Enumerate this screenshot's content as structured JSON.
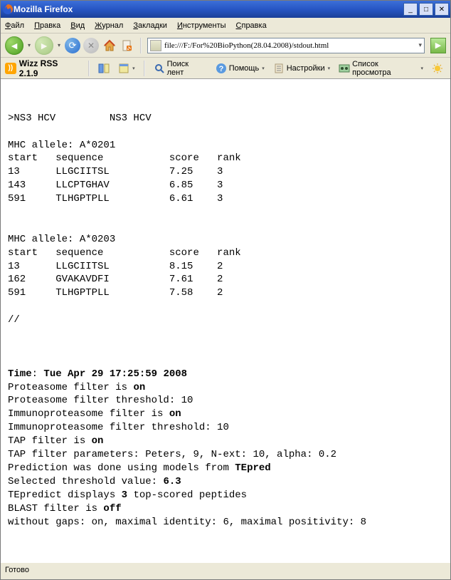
{
  "window": {
    "title": "Mozilla Firefox"
  },
  "menu": {
    "file": "Файл",
    "edit": "Правка",
    "view": "Вид",
    "history": "Журнал",
    "bookmarks": "Закладки",
    "tools": "Инструменты",
    "help": "Справка"
  },
  "url": {
    "value": "file:///F:/For%20BioPython(28.04.2008)/stdout.html"
  },
  "rss": {
    "label": "Wizz RSS 2.1.9"
  },
  "toolbar2": {
    "search": "Поиск лент",
    "help": "Помощь",
    "settings": "Настройки",
    "viewlist": "Список просмотра"
  },
  "status": {
    "text": "Готово"
  },
  "doc": {
    "header": ">NS3 HCV         NS3 HCV",
    "alleles": [
      {
        "name": "MHC allele: A*0201",
        "cols": "start   sequence           score   rank",
        "rows": [
          "13      LLGCIITSL          7.25    3",
          "143     LLCPTGHAV          6.85    3",
          "591     TLHGPTPLL          6.61    3"
        ]
      },
      {
        "name": "MHC allele: A*0203",
        "cols": "start   sequence           score   rank",
        "rows": [
          "13      LLGCIITSL          8.15    2",
          "162     GVAKAVDFI          7.61    2",
          "591     TLHGPTPLL          7.58    2"
        ]
      }
    ],
    "sep": "//",
    "time_label": "Time",
    "time_value": "Tue Apr 29 17:25:59 2008",
    "l1a": "Proteasome filter is ",
    "l1b": "on",
    "l2": "Proteasome filter threshold: 10",
    "l3a": "Immunoproteasome filter is ",
    "l3b": "on",
    "l4": "Immunoproteasome filter threshold: 10",
    "l5a": "TAP filter is ",
    "l5b": "on",
    "l6": "TAP filter parameters: Peters, 9, N-ext: 10, alpha: 0.2",
    "l7a": "Prediction was done using models from ",
    "l7b": "TEpred",
    "l8a": "Selected threshold value: ",
    "l8b": "6.3",
    "l9a": "TEpredict displays ",
    "l9b": "3",
    "l9c": " top-scored peptides",
    "l10a": "BLAST filter is ",
    "l10b": "off",
    "l11": "without gaps: on, maximal identity: 6, maximal positivity: 8"
  }
}
